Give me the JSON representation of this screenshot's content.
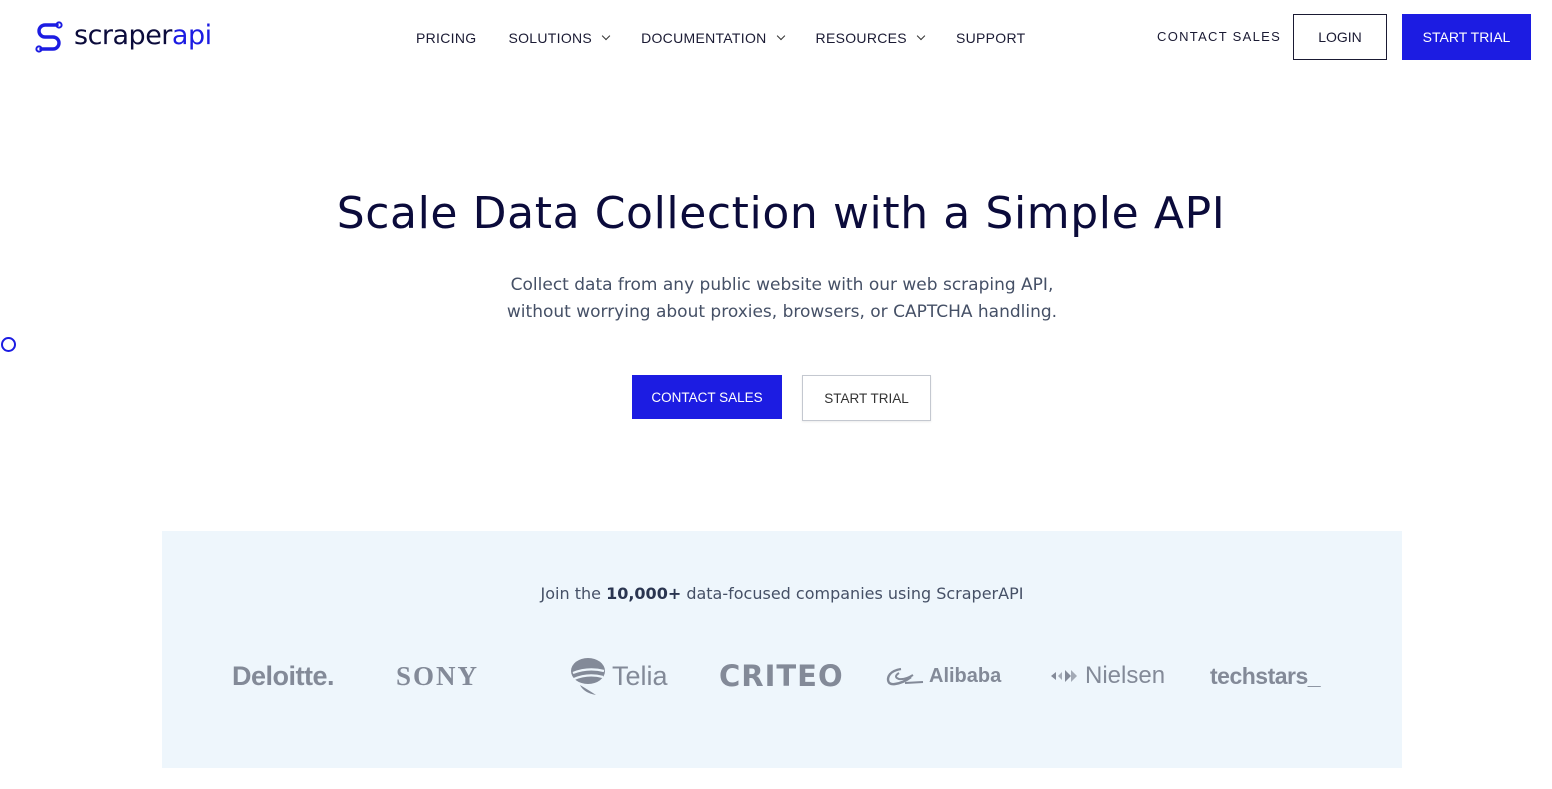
{
  "header": {
    "logo": {
      "part1": "scraper",
      "part2": "api"
    },
    "nav": [
      {
        "label": "PRICING",
        "dropdown": false
      },
      {
        "label": "SOLUTIONS",
        "dropdown": true
      },
      {
        "label": "DOCUMENTATION",
        "dropdown": true
      },
      {
        "label": "RESOURCES",
        "dropdown": true
      },
      {
        "label": "SUPPORT",
        "dropdown": false
      }
    ],
    "contact_sales": "CONTACT SALES",
    "login": "LOGIN",
    "start_trial": "START TRIAL"
  },
  "hero": {
    "title": "Scale Data Collection with a Simple API",
    "subtitle_line1": "Collect data from any public website with our web scraping API,",
    "subtitle_line2": "without worrying about proxies, browsers, or CAPTCHA handling.",
    "cta_primary": "CONTACT SALES",
    "cta_secondary": "START TRIAL"
  },
  "customers": {
    "text_before": "Join the ",
    "count": "10,000+",
    "text_after": " data-focused companies using ScraperAPI",
    "logos": [
      "Deloitte.",
      "SONY",
      "Telia",
      "CRITEO",
      "Alibaba",
      "Nielsen",
      "techstars_"
    ]
  },
  "colors": {
    "brand_blue": "#1c1ce2",
    "navy": "#0b0b3b",
    "panel_bg": "#eef6fc",
    "logo_gray": "#838a98"
  }
}
